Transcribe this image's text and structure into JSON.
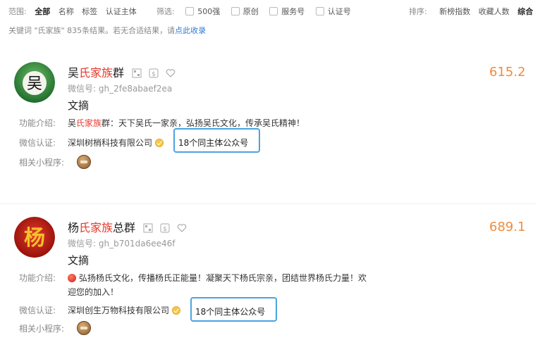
{
  "filters": {
    "scope_label": "范围:",
    "scope_options": [
      "全部",
      "名称",
      "标签",
      "认证主体"
    ],
    "filter_label": "筛选:",
    "checkboxes": [
      "500强",
      "原创",
      "服务号",
      "认证号"
    ],
    "sort_label": "排序:",
    "sort_options": [
      "新榜指数",
      "收藏人数",
      "综合"
    ]
  },
  "result_note": {
    "text": "关键词 \"氏家族\"  835条结果。若无合适结果，请",
    "link": "点此收录"
  },
  "labels": {
    "intro": "功能介绍:",
    "verify": "微信认证:",
    "mini": "相关小程序:"
  },
  "results": [
    {
      "title_pre": "吴",
      "title_hl": "氏家族",
      "title_post": "群",
      "avatar_char": "吴",
      "wxid": "微信号: gh_2fe8abaef2ea",
      "category": "文摘",
      "score": "615.2",
      "intro_pre": "吴",
      "intro_hl": "氏家族",
      "intro_post": "群：天下吴氏一家亲，弘扬吴氏文化，传承吴氏精神！",
      "verify": "深圳树梢科技有限公司",
      "same_subject": "18个同主体公众号"
    },
    {
      "title_pre": "杨",
      "title_hl": "氏家族",
      "title_post": "总群",
      "avatar_char": "杨",
      "wxid": "微信号: gh_b701da6ee46f",
      "category": "文摘",
      "score": "689.1",
      "intro_line1": "弘扬杨氏文化，传播杨氏正能量！凝聚天下杨氏宗亲，团结世界杨氏力量！欢",
      "intro_line2": "迎您的加入！",
      "verify": "深圳创生万物科技有限公司",
      "same_subject": "18个同主体公众号"
    }
  ],
  "colors": {
    "highlight": "#e8392c",
    "score": "#f08b3c",
    "box_border": "#4aa3e0",
    "link": "#2d7ad6"
  }
}
